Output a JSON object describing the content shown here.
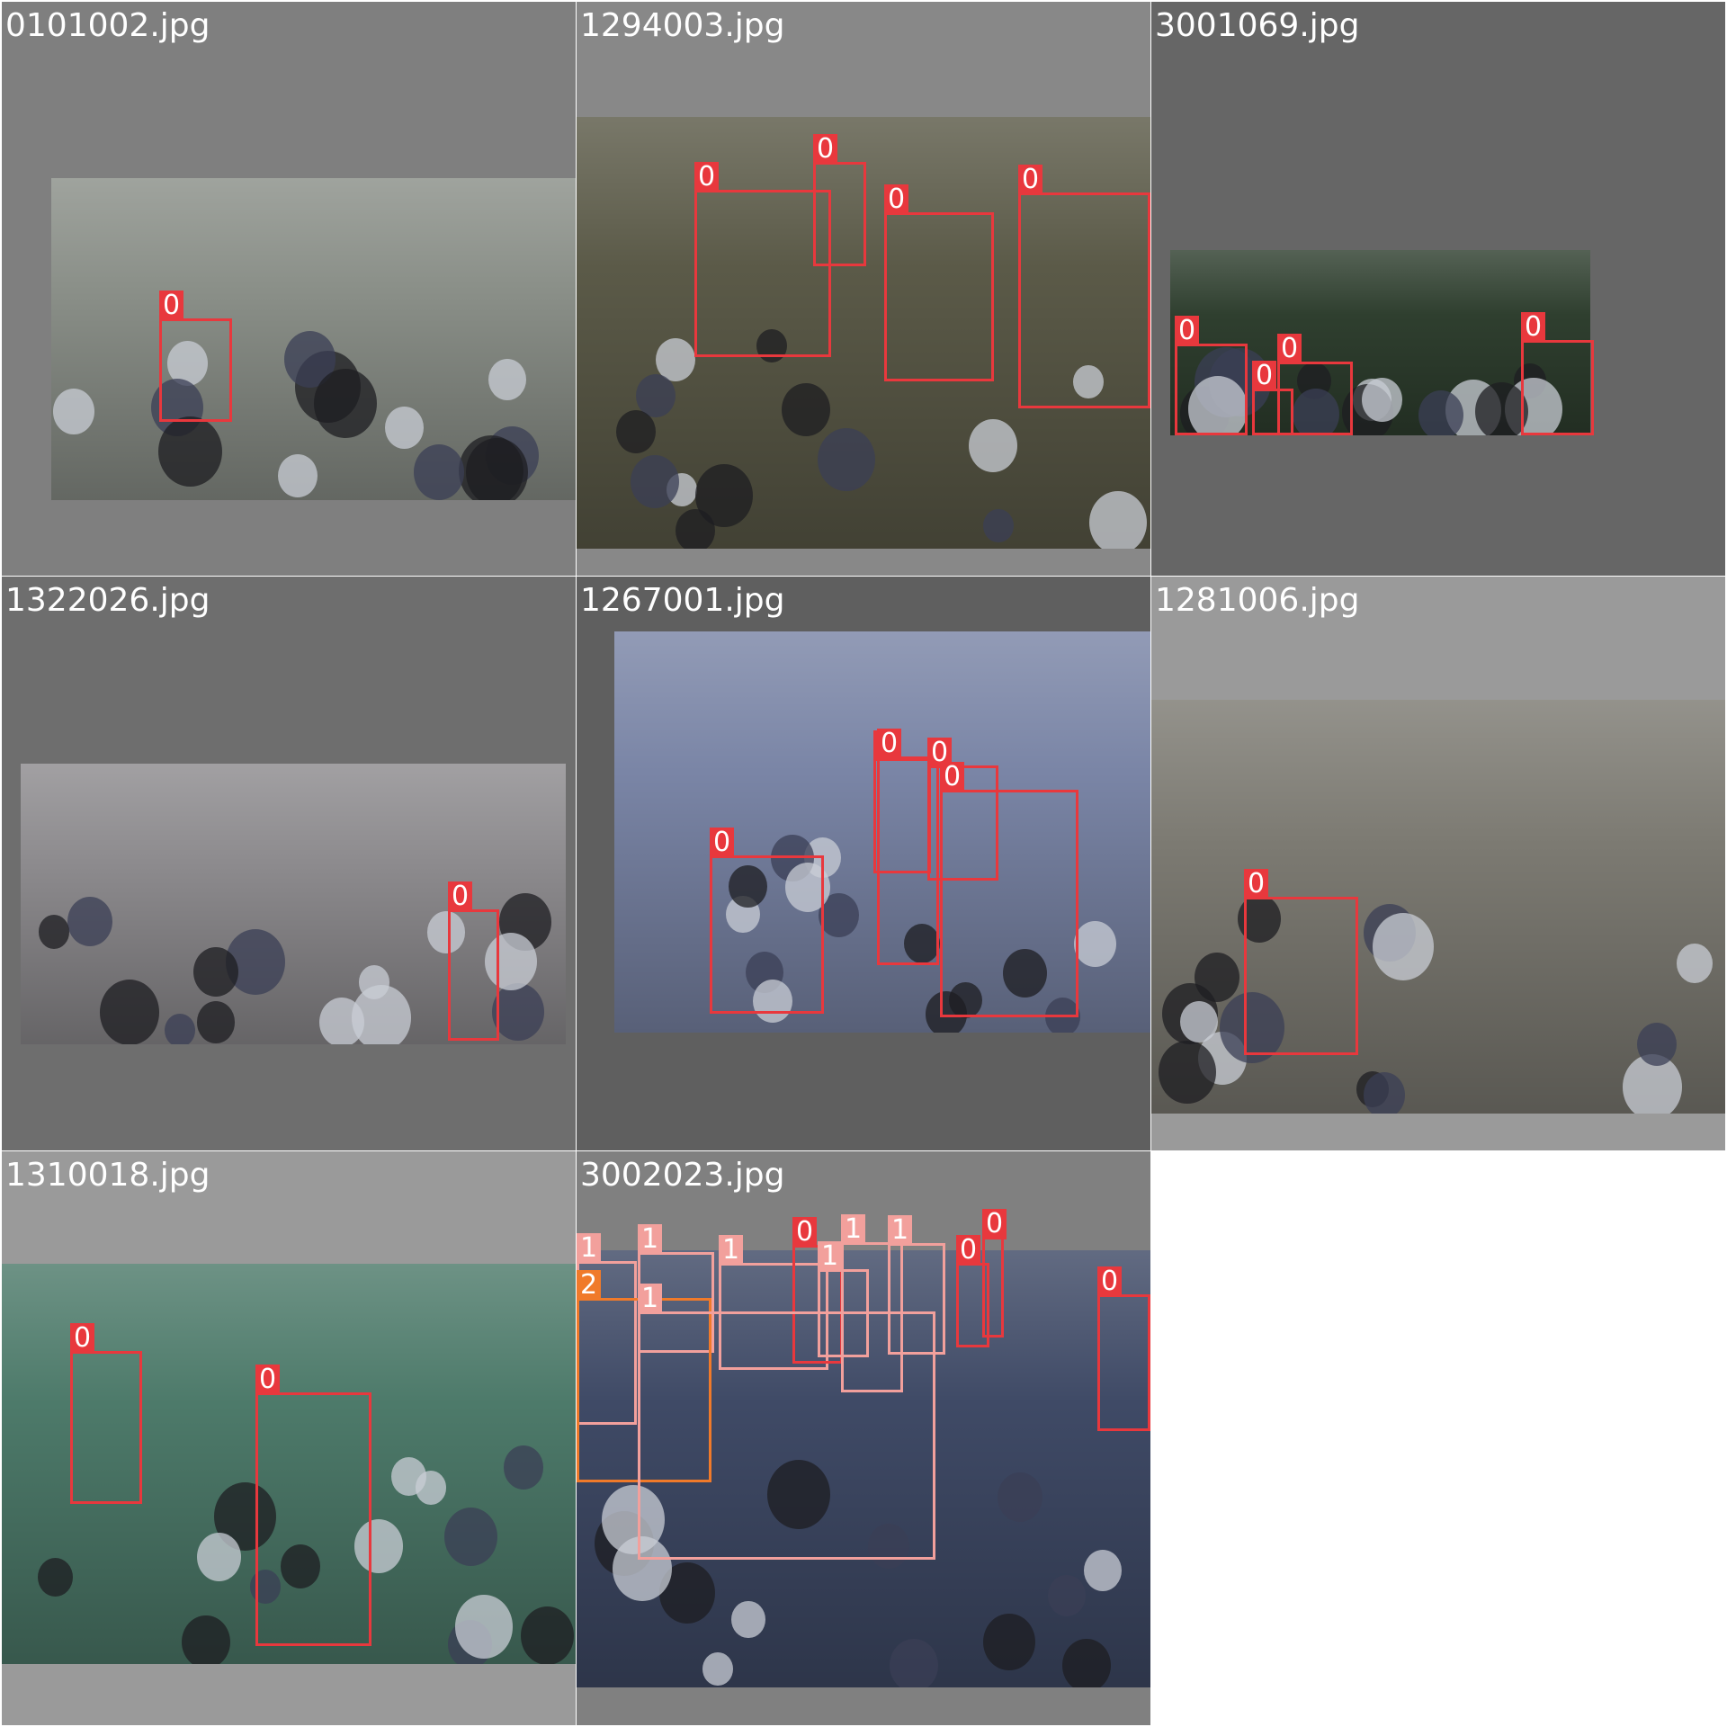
{
  "class_colors": {
    "0": "#e8383d",
    "1": "#f2a09c",
    "2": "#f07a2a"
  },
  "tiles": [
    {
      "title": "0101002.jpg",
      "bg": "#7f7f7f",
      "photo_color": "#8a8f88",
      "boxes": [
        {
          "label": "0"
        }
      ]
    },
    {
      "title": "1294003.jpg",
      "bg": "#888888",
      "photo_color": "#5b5a48",
      "boxes": [
        {
          "label": "0"
        },
        {
          "label": "0"
        },
        {
          "label": "0"
        },
        {
          "label": "0"
        }
      ]
    },
    {
      "title": "3001069.jpg",
      "bg": "#666666",
      "photo_color": "#2f3f2f",
      "boxes": [
        {
          "label": "0"
        },
        {
          "label": "0"
        },
        {
          "label": "0"
        },
        {
          "label": "0"
        }
      ]
    },
    {
      "title": "1322026.jpg",
      "bg": "#6e6e6e",
      "photo_color": "#8d8b8e",
      "boxes": [
        {
          "label": "0"
        }
      ]
    },
    {
      "title": "1267001.jpg",
      "bg": "#5f5f5f",
      "photo_color": "#7a85a6",
      "boxes": [
        {
          "label": "0"
        },
        {
          "label": "0"
        },
        {
          "label": "0"
        },
        {
          "label": "0"
        },
        {
          "label": "0"
        }
      ]
    },
    {
      "title": "1281006.jpg",
      "bg": "#9a9a9a",
      "photo_color": "#7c7a72",
      "boxes": [
        {
          "label": "0"
        }
      ]
    },
    {
      "title": "1310018.jpg",
      "bg": "#9a9a9a",
      "photo_color": "#4d7a6a",
      "boxes": [
        {
          "label": "0"
        },
        {
          "label": "0"
        }
      ]
    },
    {
      "title": "3002023.jpg",
      "bg": "#808080",
      "photo_color": "#3f4a66",
      "boxes": [
        {
          "label": "1"
        },
        {
          "label": "1"
        },
        {
          "label": "1"
        },
        {
          "label": "0"
        },
        {
          "label": "1"
        },
        {
          "label": "1"
        },
        {
          "label": "0"
        },
        {
          "label": "0"
        },
        {
          "label": "2"
        },
        {
          "label": "1"
        },
        {
          "label": "1"
        },
        {
          "label": "0"
        }
      ]
    }
  ]
}
